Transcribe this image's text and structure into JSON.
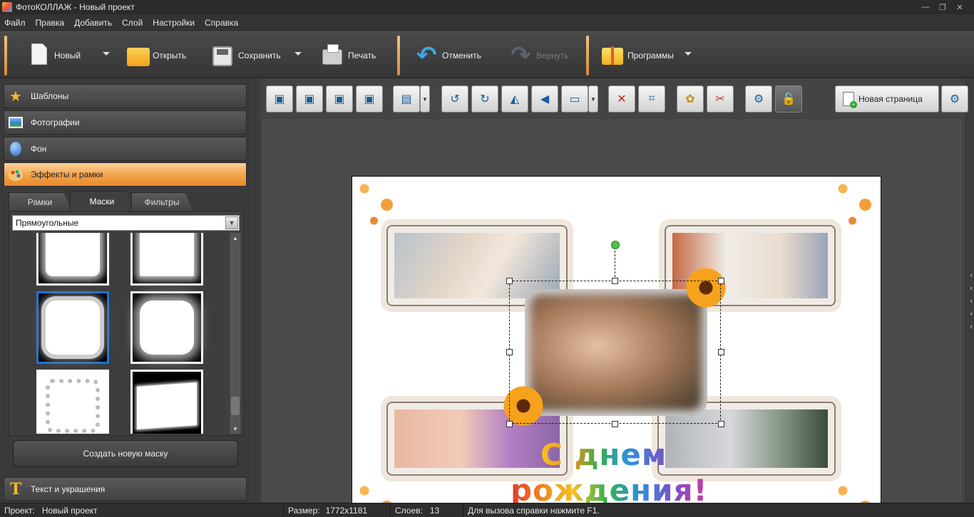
{
  "window": {
    "title": "ФотоКОЛЛАЖ - Новый проект"
  },
  "menu": [
    "Файл",
    "Правка",
    "Добавить",
    "Слой",
    "Настройки",
    "Справка"
  ],
  "toolbar": {
    "new": "Новый",
    "open": "Открыть",
    "save": "Сохранить",
    "print": "Печать",
    "undo": "Отменить",
    "redo": "Вернуть",
    "programs": "Программы"
  },
  "sidebar": {
    "sections": [
      {
        "label": "Шаблоны",
        "icon": "star-icon"
      },
      {
        "label": "Фотографии",
        "icon": "photo-icon"
      },
      {
        "label": "Фон",
        "icon": "balloon-icon"
      },
      {
        "label": "Эффекты и рамки",
        "icon": "palette-icon",
        "active": true
      }
    ],
    "tabs": [
      {
        "label": "Рамки"
      },
      {
        "label": "Маски",
        "active": true
      },
      {
        "label": "Фильтры"
      }
    ],
    "mask_category": "Прямоугольные",
    "create_mask": "Создать новую маску",
    "text_section": "Текст и украшения"
  },
  "canvas": {
    "new_page": "Новая страница",
    "greeting_line1": "С днем",
    "greeting_line2": "рождения!"
  },
  "status": {
    "project_label": "Проект:",
    "project_value": "Новый проект",
    "size_label": "Размер:",
    "size_value": "1772x1181",
    "layers_label": "Слоев:",
    "layers_value": "13",
    "hint": "Для вызова справки нажмите F1."
  },
  "colors": {
    "accent_orange": "#f2a24b",
    "selection_blue": "#1c74d6",
    "rotate_handle": "#4fc04d"
  }
}
